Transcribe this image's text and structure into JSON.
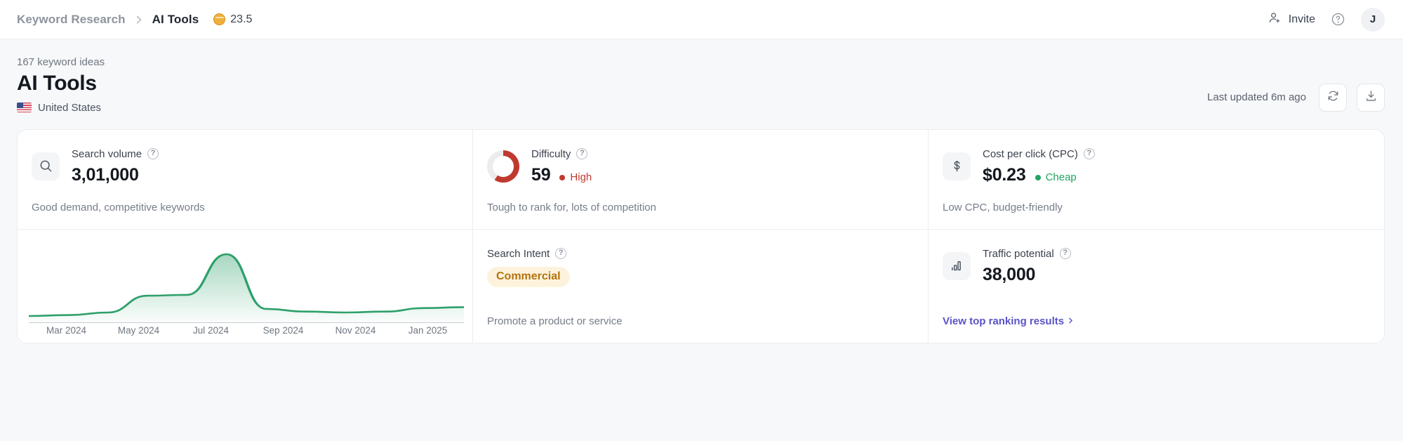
{
  "topbar": {
    "breadcrumb": {
      "parent": "Keyword Research",
      "separator_icon": "chevron-right-icon",
      "current": "AI Tools"
    },
    "credits": {
      "icon": "coin-icon",
      "value": "23.5"
    },
    "invite": {
      "icon": "person-add-icon",
      "label": "Invite"
    },
    "help": {
      "icon": "help-circle-icon"
    },
    "avatar": {
      "initial": "J"
    }
  },
  "page_head": {
    "ideas_count": "167 keyword ideas",
    "title": "AI Tools",
    "locale": {
      "flag": "us-flag-icon",
      "label": "United States"
    },
    "last_updated": "Last updated 6m ago",
    "refresh_icon": "refresh-icon",
    "download_icon": "download-icon"
  },
  "cards": {
    "search_volume": {
      "icon": "magnifier-icon",
      "label": "Search volume",
      "help_icon": "help-circle-icon",
      "value": "3,01,000",
      "description": "Good demand, competitive keywords"
    },
    "difficulty": {
      "icon": "donut-gauge-icon",
      "label": "Difficulty",
      "help_icon": "help-circle-icon",
      "value": "59",
      "tag": "High",
      "tag_color": "#c0392f",
      "gauge_percent": 59,
      "gauge_track_color": "#ececee",
      "description": "Tough to rank for, lots of competition"
    },
    "cpc": {
      "icon": "dollar-icon",
      "label": "Cost per click (CPC)",
      "help_icon": "help-circle-icon",
      "value": "$0.23",
      "tag": "Cheap",
      "tag_color": "#22a463",
      "description": "Low CPC, budget-friendly"
    },
    "search_intent": {
      "label": "Search Intent",
      "help_icon": "help-circle-icon",
      "pill": "Commercial",
      "pill_text_color": "#b4730d",
      "pill_bg_color": "#fdf3dd",
      "description": "Promote a product or service"
    },
    "traffic_potential": {
      "icon": "bar-chart-icon",
      "label": "Traffic potential",
      "help_icon": "help-circle-icon",
      "value": "38,000",
      "link": "View top ranking results",
      "link_arrow": "chevron-right-icon",
      "link_color": "#5b53c8"
    }
  },
  "chart_data": {
    "type": "area",
    "title": "",
    "xlabel": "",
    "ylabel": "",
    "line_color": "#2ea06a",
    "fill_color": "#2ea06a",
    "grid": false,
    "legend": "none",
    "categories": [
      "Mar 2024",
      "May 2024",
      "Jul 2024",
      "Sep 2024",
      "Nov 2024",
      "Jan 2025"
    ],
    "x": [
      "Feb 2024",
      "Mar 2024",
      "Apr 2024",
      "May 2024",
      "Jun 2024",
      "Jul 2024",
      "Aug 2024",
      "Sep 2024",
      "Oct 2024",
      "Nov 2024",
      "Dec 2024",
      "Jan 2025"
    ],
    "values": [
      4,
      5,
      8,
      27,
      28,
      74,
      12,
      9,
      8,
      9,
      13,
      14
    ],
    "ylim": [
      0,
      100
    ]
  }
}
